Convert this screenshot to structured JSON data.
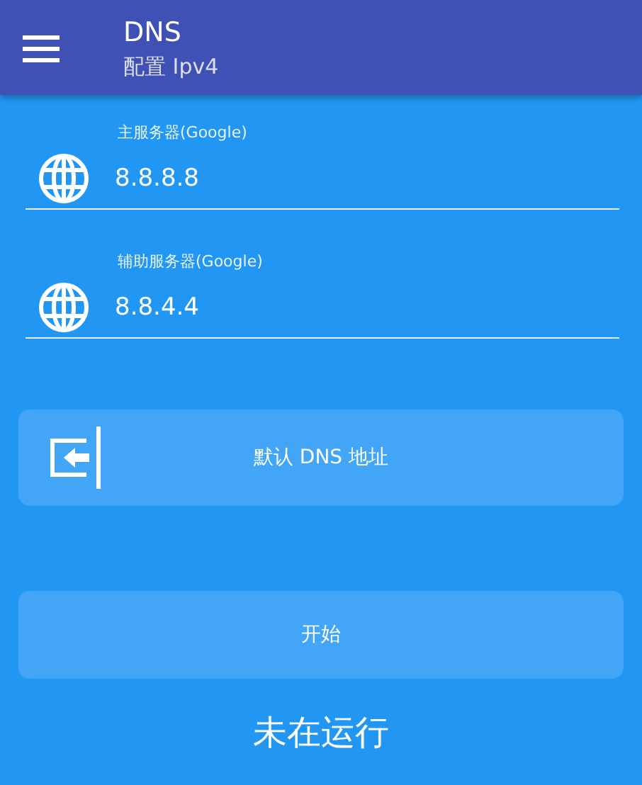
{
  "app_bar": {
    "title": "DNS",
    "subtitle": "配置 Ipv4"
  },
  "fields": [
    {
      "label": "主服务器(Google)",
      "value": "8.8.8.8"
    },
    {
      "label": "辅助服务器(Google)",
      "value": "8.8.4.4"
    }
  ],
  "default_button": {
    "label": "默认 DNS 地址"
  },
  "start_button": {
    "label": "开始"
  },
  "status": "未在运行"
}
